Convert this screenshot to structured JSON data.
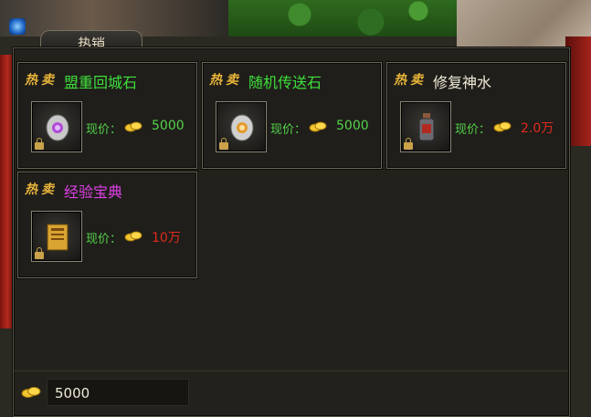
{
  "colors": {
    "accent_gold": "#e8b43a",
    "name_green": "#3fe03c",
    "name_white": "#f0ead8",
    "name_magenta": "#e040e8",
    "price_green": "#55d24a",
    "price_red": "#e22a1c"
  },
  "panel": {
    "tab_title": "热销",
    "hot_badge": "热卖",
    "price_label": "现价："
  },
  "items": [
    {
      "name": "盟重回城石",
      "price": "5000",
      "name_color": "green",
      "price_color": "green",
      "icon": "return-stone-icon"
    },
    {
      "name": "随机传送石",
      "price": "5000",
      "name_color": "green",
      "price_color": "green",
      "icon": "teleport-stone-icon"
    },
    {
      "name": "修复神水",
      "price": "2.0万",
      "name_color": "white",
      "price_color": "red",
      "icon": "repair-potion-icon"
    },
    {
      "name": "经验宝典",
      "price": "10万",
      "name_color": "magenta",
      "price_color": "red",
      "icon": "exp-book-icon"
    }
  ],
  "wallet": {
    "gold": "5000",
    "icon": "gold-coin-icon"
  }
}
